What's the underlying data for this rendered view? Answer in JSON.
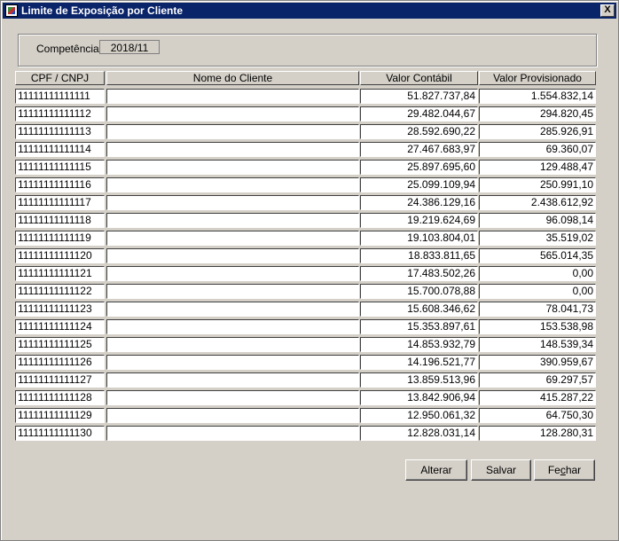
{
  "window": {
    "title": "Limite de Exposição por Cliente",
    "close_label": "X"
  },
  "filter": {
    "label": "Competência",
    "value": "2018/11"
  },
  "table": {
    "headers": [
      "CPF / CNPJ",
      "Nome do Cliente",
      "Valor Contábil",
      "Valor Provisionado"
    ],
    "rows": [
      {
        "cpf": "11111111111111",
        "nome": "",
        "contabil": "51.827.737,84",
        "provisionado": "1.554.832,14"
      },
      {
        "cpf": "11111111111112",
        "nome": "",
        "contabil": "29.482.044,67",
        "provisionado": "294.820,45"
      },
      {
        "cpf": "11111111111113",
        "nome": "",
        "contabil": "28.592.690,22",
        "provisionado": "285.926,91"
      },
      {
        "cpf": "11111111111114",
        "nome": "",
        "contabil": "27.467.683,97",
        "provisionado": "69.360,07"
      },
      {
        "cpf": "11111111111115",
        "nome": "",
        "contabil": "25.897.695,60",
        "provisionado": "129.488,47"
      },
      {
        "cpf": "11111111111116",
        "nome": "",
        "contabil": "25.099.109,94",
        "provisionado": "250.991,10"
      },
      {
        "cpf": "11111111111117",
        "nome": "",
        "contabil": "24.386.129,16",
        "provisionado": "2.438.612,92"
      },
      {
        "cpf": "11111111111118",
        "nome": "",
        "contabil": "19.219.624,69",
        "provisionado": "96.098,14"
      },
      {
        "cpf": "11111111111119",
        "nome": "",
        "contabil": "19.103.804,01",
        "provisionado": "35.519,02"
      },
      {
        "cpf": "11111111111120",
        "nome": "",
        "contabil": "18.833.811,65",
        "provisionado": "565.014,35"
      },
      {
        "cpf": "11111111111121",
        "nome": "",
        "contabil": "17.483.502,26",
        "provisionado": "0,00"
      },
      {
        "cpf": "11111111111122",
        "nome": "",
        "contabil": "15.700.078,88",
        "provisionado": "0,00"
      },
      {
        "cpf": "11111111111123",
        "nome": "",
        "contabil": "15.608.346,62",
        "provisionado": "78.041,73"
      },
      {
        "cpf": "11111111111124",
        "nome": "",
        "contabil": "15.353.897,61",
        "provisionado": "153.538,98"
      },
      {
        "cpf": "11111111111125",
        "nome": "",
        "contabil": "14.853.932,79",
        "provisionado": "148.539,34"
      },
      {
        "cpf": "11111111111126",
        "nome": "",
        "contabil": "14.196.521,77",
        "provisionado": "390.959,67"
      },
      {
        "cpf": "11111111111127",
        "nome": "",
        "contabil": "13.859.513,96",
        "provisionado": "69.297,57"
      },
      {
        "cpf": "11111111111128",
        "nome": "",
        "contabil": "13.842.906,94",
        "provisionado": "415.287,22"
      },
      {
        "cpf": "11111111111129",
        "nome": "",
        "contabil": "12.950.061,32",
        "provisionado": "64.750,30"
      },
      {
        "cpf": "11111111111130",
        "nome": "",
        "contabil": "12.828.031,14",
        "provisionado": "128.280,31"
      }
    ]
  },
  "buttons": {
    "alterar": "Alterar",
    "salvar": "Salvar",
    "fechar": "Fechar"
  },
  "colors": {
    "titlebar": "#0a246a",
    "face": "#d4d0c8"
  }
}
